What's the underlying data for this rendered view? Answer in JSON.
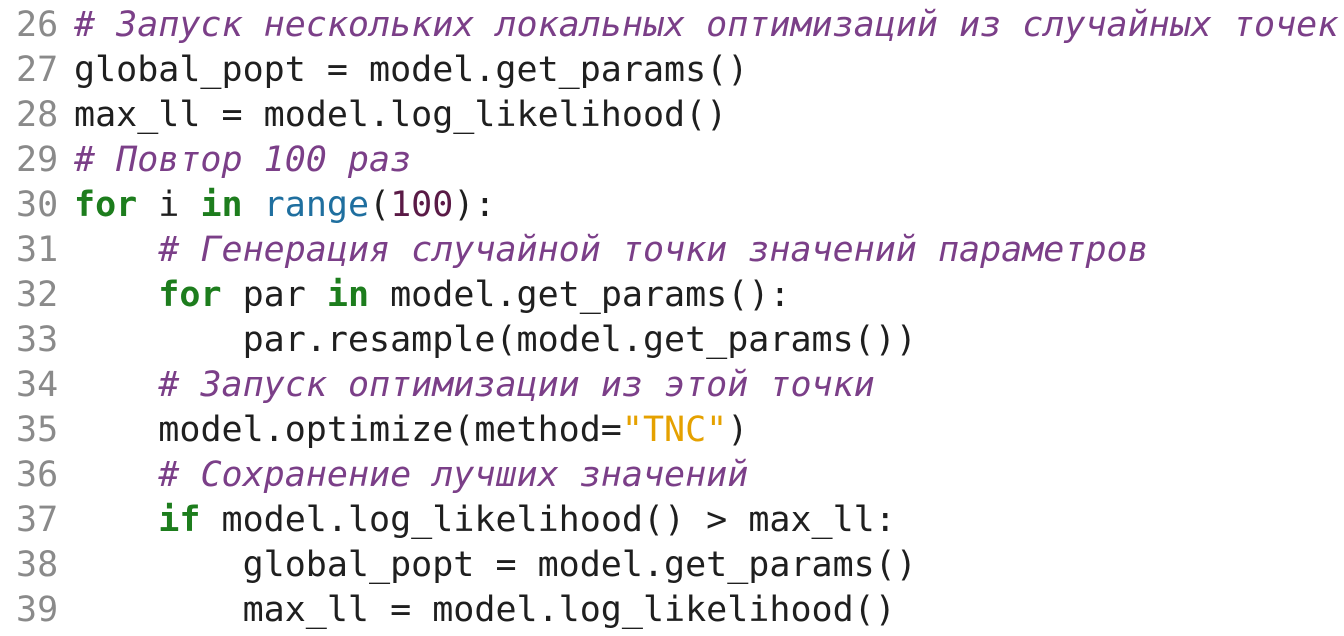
{
  "colors": {
    "background": "#ffffff",
    "line_number": "#8a8a8a",
    "plain": "#1f1f1f",
    "comment": "#7b3f88",
    "keyword": "#1d7d1d",
    "builtin": "#1f6f9f",
    "number": "#5a1a46",
    "string": "#e5a100"
  },
  "lines": [
    {
      "number": "26",
      "indent": "",
      "tokens": [
        {
          "t": "comment",
          "text": "# Запуск нескольких локальных оптимизаций из случайных точек"
        }
      ]
    },
    {
      "number": "27",
      "indent": "",
      "tokens": [
        {
          "t": "plain",
          "text": "global_popt = model.get_params()"
        }
      ]
    },
    {
      "number": "28",
      "indent": "",
      "tokens": [
        {
          "t": "plain",
          "text": "max_ll = model.log_likelihood()"
        }
      ]
    },
    {
      "number": "29",
      "indent": "",
      "tokens": [
        {
          "t": "comment",
          "text": "# Повтор 100 раз"
        }
      ]
    },
    {
      "number": "30",
      "indent": "",
      "tokens": [
        {
          "t": "keyword",
          "text": "for"
        },
        {
          "t": "plain",
          "text": " i "
        },
        {
          "t": "keyword",
          "text": "in"
        },
        {
          "t": "plain",
          "text": " "
        },
        {
          "t": "builtin",
          "text": "range"
        },
        {
          "t": "plain",
          "text": "("
        },
        {
          "t": "number",
          "text": "100"
        },
        {
          "t": "plain",
          "text": "):"
        }
      ]
    },
    {
      "number": "31",
      "indent": "    ",
      "tokens": [
        {
          "t": "comment",
          "text": "# Генерация случайной точки значений параметров"
        }
      ]
    },
    {
      "number": "32",
      "indent": "    ",
      "tokens": [
        {
          "t": "keyword",
          "text": "for"
        },
        {
          "t": "plain",
          "text": " par "
        },
        {
          "t": "keyword",
          "text": "in"
        },
        {
          "t": "plain",
          "text": " model.get_params():"
        }
      ]
    },
    {
      "number": "33",
      "indent": "        ",
      "tokens": [
        {
          "t": "plain",
          "text": "par.resample(model.get_params())"
        }
      ]
    },
    {
      "number": "34",
      "indent": "    ",
      "tokens": [
        {
          "t": "comment",
          "text": "# Запуск оптимизации из этой точки"
        }
      ]
    },
    {
      "number": "35",
      "indent": "    ",
      "tokens": [
        {
          "t": "plain",
          "text": "model.optimize(method="
        },
        {
          "t": "string",
          "text": "\"TNC\""
        },
        {
          "t": "plain",
          "text": ")"
        }
      ]
    },
    {
      "number": "36",
      "indent": "    ",
      "tokens": [
        {
          "t": "comment",
          "text": "# Сохранение лучших значений"
        }
      ]
    },
    {
      "number": "37",
      "indent": "    ",
      "tokens": [
        {
          "t": "keyword",
          "text": "if"
        },
        {
          "t": "plain",
          "text": " model.log_likelihood() > max_ll:"
        }
      ]
    },
    {
      "number": "38",
      "indent": "        ",
      "tokens": [
        {
          "t": "plain",
          "text": "global_popt = model.get_params()"
        }
      ]
    },
    {
      "number": "39",
      "indent": "        ",
      "tokens": [
        {
          "t": "plain",
          "text": "max_ll = model.log_likelihood()"
        }
      ]
    }
  ]
}
